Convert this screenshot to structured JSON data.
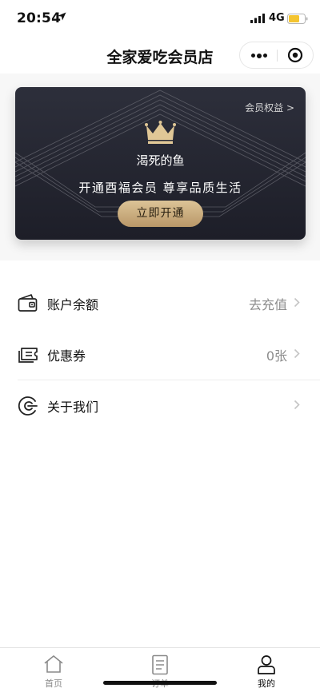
{
  "status_bar": {
    "time": "20:54",
    "network": "4G"
  },
  "nav": {
    "title": "全家爱吃会员店"
  },
  "member_card": {
    "benefits_link": "会员权益 >",
    "username": "渴死的鱼",
    "slogan": "开通酉福会员  尊享品质生活",
    "open_button": "立即开通"
  },
  "menu": {
    "items": [
      {
        "label": "账户余额",
        "value": "去充值",
        "icon": "wallet-icon"
      },
      {
        "label": "优惠券",
        "value": "0张",
        "icon": "coupon-icon"
      },
      {
        "label": "关于我们",
        "value": "",
        "icon": "about-icon"
      }
    ]
  },
  "tab_bar": {
    "tabs": [
      {
        "label": "首页",
        "icon": "home-icon"
      },
      {
        "label": "订单",
        "icon": "order-icon"
      },
      {
        "label": "我的",
        "icon": "user-icon",
        "active": true
      }
    ]
  },
  "colors": {
    "card_dark": "#1d1e28",
    "gold": "#c9ac7c",
    "text_gray": "#8c8c8c"
  }
}
